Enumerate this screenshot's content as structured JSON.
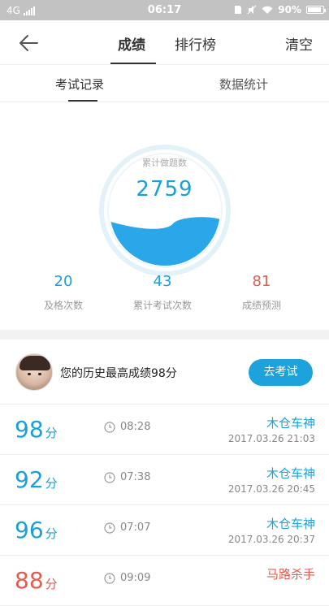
{
  "status_bar": {
    "network": "4G",
    "time": "06:17",
    "battery": "90%",
    "battery_level": 0.9
  },
  "nav": {
    "tabs": [
      {
        "label": "成绩",
        "active": true
      },
      {
        "label": "排行榜",
        "active": false
      }
    ],
    "clear_label": "清空"
  },
  "sub_tabs": [
    {
      "label": "考试记录",
      "active": true
    },
    {
      "label": "数据统计",
      "active": false
    }
  ],
  "stats": {
    "gauge_title": "累计做题数",
    "gauge_value": "2759",
    "gauge_fill": 0.38,
    "metrics": [
      {
        "value": "20",
        "label": "及格次数",
        "color": "#1a9fd8"
      },
      {
        "value": "43",
        "label": "累计考试次数",
        "color": "#1a9fd8"
      },
      {
        "value": "81",
        "label": "成绩预测",
        "color": "#e05d4f"
      }
    ]
  },
  "best": {
    "text": "您的历史最高成绩98分",
    "button": "去考试"
  },
  "records": [
    {
      "score": "98",
      "unit": "分",
      "duration": "08:28",
      "user": "木仓车神",
      "date": "2017.03.26   21:03",
      "color": "#1a9fd8"
    },
    {
      "score": "92",
      "unit": "分",
      "duration": "07:38",
      "user": "木仓车神",
      "date": "2017.03.26   20:45",
      "color": "#1a9fd8"
    },
    {
      "score": "96",
      "unit": "分",
      "duration": "07:07",
      "user": "木仓车神",
      "date": "2017.03.26   20:37",
      "color": "#1a9fd8"
    },
    {
      "score": "88",
      "unit": "分",
      "duration": "09:09",
      "user": "马路杀手",
      "date": "",
      "color": "#e05d4f"
    }
  ],
  "colors": {
    "accent": "#1ea2dc",
    "warning": "#e05d4f"
  }
}
